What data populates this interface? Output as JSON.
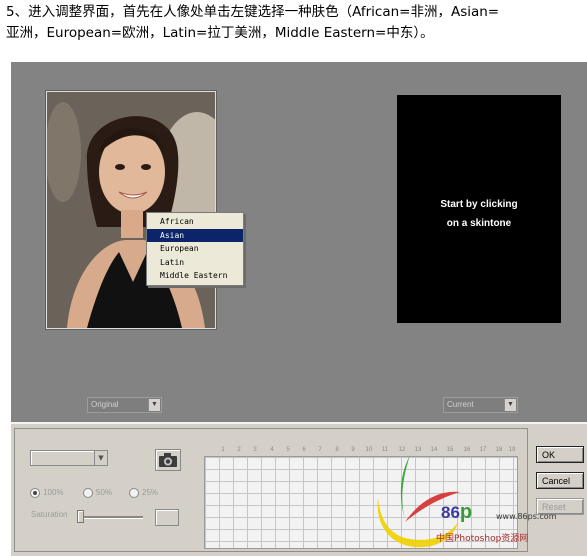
{
  "instruction": {
    "line1": "5、进入调整界面，首先在人像处单击左键选择一种肤色（African=非洲，Asian=",
    "line2": "亚洲，European=欧洲，Latin=拉丁美洲，Middle Eastern=中东）。"
  },
  "context_menu": {
    "items": [
      "African",
      "Asian",
      "European",
      "Latin",
      "Middle Eastern"
    ],
    "selected": "Asian"
  },
  "preview": {
    "message_line1": "Start by clicking",
    "message_line2": "on a skintone"
  },
  "selects": {
    "original": "Original",
    "current": "Current"
  },
  "ticks": [
    "1",
    "2",
    "3",
    "4",
    "5",
    "6",
    "7",
    "8",
    "9",
    "10",
    "11",
    "12",
    "13",
    "14",
    "15",
    "16",
    "17",
    "18",
    "19"
  ],
  "radios": [
    {
      "label": "100%",
      "checked": true
    },
    {
      "label": "50%",
      "checked": false
    },
    {
      "label": "25%",
      "checked": false
    }
  ],
  "saturation_label": "Saturation",
  "buttons": {
    "ok": "OK",
    "cancel": "Cancel",
    "reset": "Reset"
  },
  "watermark": {
    "num": "86",
    "p": "p",
    "url": "www.86ps.com",
    "name": "中国Photoshop资源网"
  }
}
